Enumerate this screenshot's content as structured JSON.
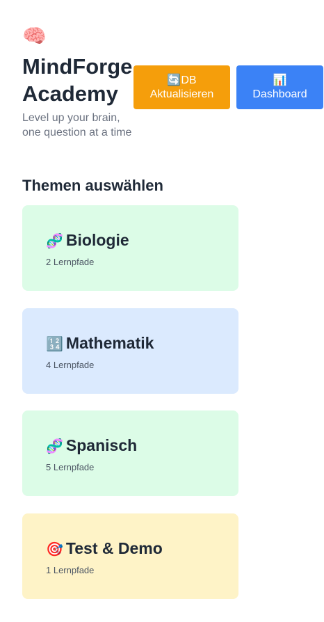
{
  "header": {
    "icon": "🧠",
    "title_line1": "MindForge",
    "title_line2": "Academy",
    "tagline": "Level up your brain, one question at a time"
  },
  "actions": {
    "refresh": {
      "icon": "🔄",
      "label_line1": "DB",
      "label_line2": "Aktualisieren",
      "color": "#f59e0b"
    },
    "dashboard": {
      "icon": "📊",
      "label": "Dashboard",
      "color": "#3b82f6"
    }
  },
  "topics_section": {
    "heading": "Themen auswählen",
    "topics": [
      {
        "icon": "🧬",
        "name": "Biologie",
        "count": "2 Lernpfade",
        "color": "#dcfce7"
      },
      {
        "icon": "🔢",
        "name": "Mathematik",
        "count": "4 Lernpfade",
        "color": "#dbeafe"
      },
      {
        "icon": "🧬",
        "name": "Spanisch",
        "count": "5 Lernpfade",
        "color": "#dcfce7"
      },
      {
        "icon": "🎯",
        "name": "Test & Demo",
        "count": "1 Lernpfade",
        "color": "#fef3c7"
      }
    ]
  }
}
